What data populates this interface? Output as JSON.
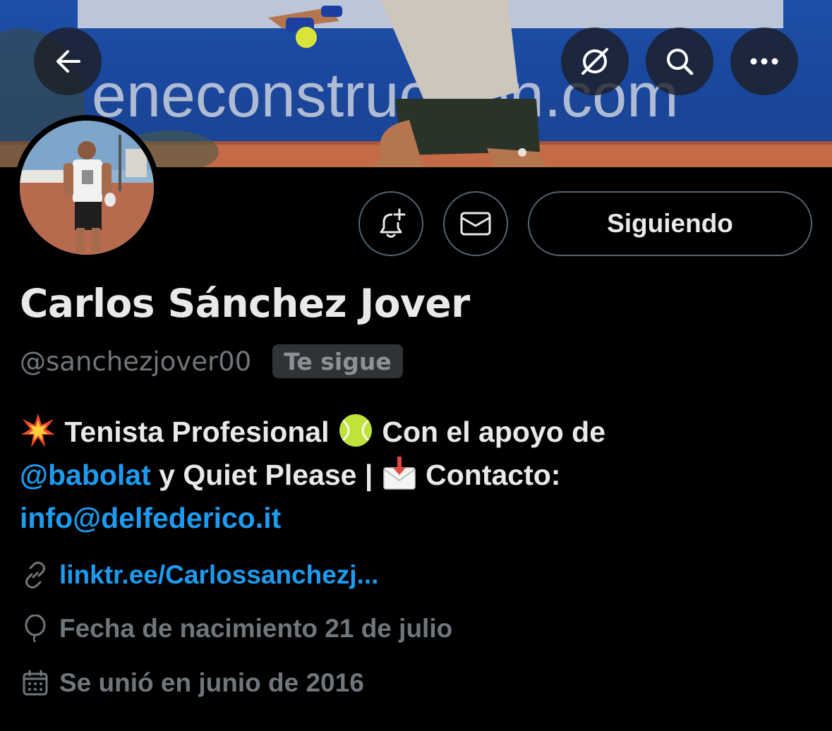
{
  "header": {
    "banner_text": "eneconstruccion.com",
    "back_icon": "arrow-left-icon",
    "actions": [
      {
        "name": "grok-icon"
      },
      {
        "name": "search-icon"
      },
      {
        "name": "more-icon"
      }
    ]
  },
  "profile": {
    "display_name": "Carlos Sánchez Jover",
    "handle": "@sanchezjover00",
    "follows_you_badge": "Te sigue",
    "following_button": "Siguiendo",
    "notification_icon": "bell-plus-icon",
    "message_icon": "envelope-icon"
  },
  "bio": {
    "line1_text_a": " Tenista Profesional ",
    "line1_text_b": " Con el apoyo de",
    "mention": "@babolat",
    "line2_text_a": " y Quiet Please | ",
    "line2_text_b": " Contacto:",
    "email": "info@delfederico.it"
  },
  "meta": {
    "website": "linktr.ee/Carlossanchezj...",
    "birthday": "Fecha de nacimiento 21 de julio",
    "joined": "Se unió en junio de 2016"
  },
  "colors": {
    "background": "#000000",
    "text_primary": "#e7e9ea",
    "text_secondary": "#71767b",
    "link": "#1d9bf0",
    "border": "#536471"
  }
}
